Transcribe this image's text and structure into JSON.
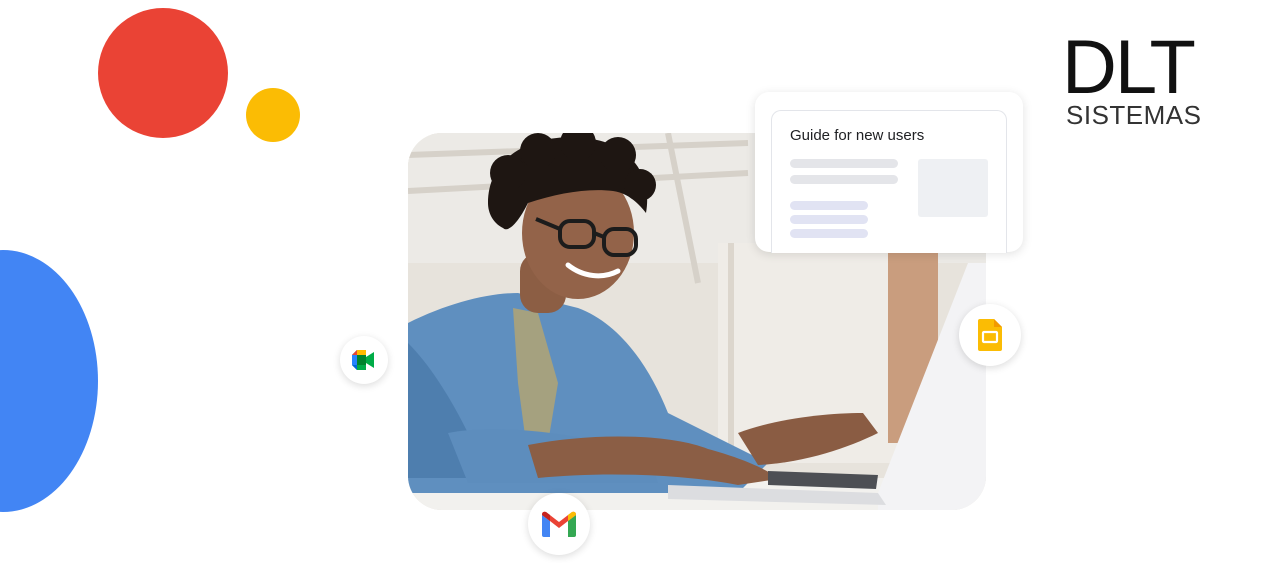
{
  "logo": {
    "main": "DLT",
    "sub": "SISTEMAS"
  },
  "card": {
    "title": "Guide for new users"
  },
  "icons": {
    "meet": "google-meet-icon",
    "slides": "google-slides-icon",
    "gmail": "gmail-icon"
  },
  "colors": {
    "red": "#ea4335",
    "yellow": "#fbbc04",
    "blue": "#4285f4",
    "green": "#34a853"
  }
}
